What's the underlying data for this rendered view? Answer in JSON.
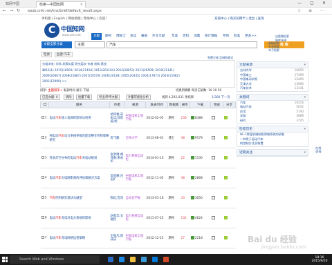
{
  "browser": {
    "tab_inactive": "知网中国",
    "tab_active": "检索—中国知网",
    "url": "epub.cnki.net/kns/brief/default_result.aspx",
    "win_controls": [
      "—",
      "▢",
      "✕"
    ]
  },
  "topline": {
    "left": "手机版 | English | 网站地图 | 帮助中心 | 欢迎！",
    "right": "充值中心 | 购买知网卡 | 退出 | 查询"
  },
  "logo": {
    "main": "中国知网",
    "letter": "C",
    "site": "www.cnki.net"
  },
  "db_tabs": [
    "文献",
    "期刊",
    "博硕士",
    "会议",
    "报纸",
    "外文文献",
    "年鉴",
    "百科",
    "词典",
    "统计数据",
    "专利",
    "标准",
    "更多>>"
  ],
  "side_links": [
    "出版物检索",
    "跨库选择",
    "新版入口",
    "充值",
    "服务导航"
  ],
  "search": {
    "scope_label": "文献全部分类",
    "field": "主题",
    "query": "汽车",
    "button": "检 索",
    "advanced": [
      "高级检索",
      "专业检索",
      "句子检索",
      "一框式检索"
    ]
  },
  "crumb": {
    "chips": [
      "检索",
      "主题:汽车"
    ],
    "right": "免费订阅  定制检索式"
  },
  "filter": {
    "row1": "分组浏览: 学科 发表年度 研究层次 作者 机构 基金",
    "row2": "2016(1)  2015(16991)  2014(21416)  2013(201104)  2012(28053)  2011(26509)  2010(31141)",
    "row3": "2009(26667)  2008(25887)  2007(20578)  2006(20138)  2005(20445)  2004(17873)  2003(15082)",
    "row4": "2002(12990)  >>",
    "close": "×"
  },
  "sort": {
    "label": "排序:",
    "active": "主题排序↓",
    "others": "发表时间 被引 下载",
    "right": "切换到摘要  每页记录数: 10 20 50"
  },
  "actions": {
    "buttons": [
      "已选文献: 0",
      "清除",
      "批量下载",
      "导出/参考文献",
      "计量可视化分析"
    ],
    "count": "找到 4,292,031 条结果",
    "pager": "1/300 下一页"
  },
  "table": {
    "headers": [
      "",
      "题名",
      "作者",
      "来源",
      "发表时间",
      "数据库",
      "被引",
      "下载",
      "预览",
      "分享"
    ],
    "rows": [
      {
        "n": "1",
        "title_a": "电动",
        "title_hl": "汽车",
        "title_b": "接入电网的影响与利用",
        "author": "胡泽春;宋永华;徐智威;胡",
        "source": "中国电机工程学报",
        "date": "2012-02-05",
        "db": "期刊",
        "cite": "236",
        "down": "8388"
      },
      {
        "n": "2",
        "title_a": "纯电动",
        "title_hl": "汽车",
        "title_b": "动力系统参数匹配及整车控制策略研究",
        "author": "周飞鲲",
        "source": "吉林大学",
        "date": "2013-06-01",
        "db": "博士",
        "cite": "38",
        "down": "9579"
      },
      {
        "n": "3",
        "title_a": "考虑灯空分布的电动",
        "title_hl": "汽车",
        "title_b": "充电站规划",
        "author": "张洪财;胡泽春;宋永华",
        "source": "电力系统自动化",
        "date": "2014-01-10",
        "db": "期刊",
        "cite": "22",
        "down": "1530"
      },
      {
        "n": "4",
        "title_a": "电动",
        "title_hl": "汽车",
        "title_b": "对电网影响的评估和解决方案",
        "author": "高亚静;吕孟扩",
        "source": "中国电机工程学报",
        "date": "2012-11-05",
        "db": "期刊",
        "cite": "38",
        "down": "2868"
      },
      {
        "n": "5",
        "title_a": "",
        "title_hl": "汽车",
        "title_b": "控制研究现状与展望",
        "author": "陈虹;宫洵",
        "source": "自动化学报",
        "date": "2013-01-16",
        "db": "期刊",
        "cite": "33",
        "down": "3050"
      },
      {
        "n": "6",
        "title_a": "电动",
        "title_hl": "汽车",
        "title_b": "充电对电力系统的影响",
        "author": "赵俊华;文福拴",
        "source": "电力系统自动化",
        "date": "2011-07-25",
        "db": "期刊",
        "cite": "132",
        "down": "4624"
      },
      {
        "n": "7",
        "title_a": "电动",
        "title_hl": "汽车",
        "title_b": "充电网络运营策略",
        "author": "王锡凡;邵成成",
        "source": "中国电机工程学报",
        "date": "2012-12-25",
        "db": "期刊",
        "cite": "27",
        "down": "2218"
      }
    ]
  },
  "panels": [
    {
      "title": "文献来源",
      "rows": [
        [
          "吉林大学",
          "16055"
        ],
        [
          "中国电工",
          "17499"
        ],
        [
          "中国电动学报",
          "15405"
        ],
        [
          "天津大学",
          "13965"
        ],
        [
          "汽车技术",
          "13141"
        ]
      ]
    },
    {
      "title": "关键词",
      "rows": [
        [
          "汽车",
          "19216"
        ],
        [
          "电动汽车",
          "5042"
        ],
        [
          "应用",
          "5740"
        ],
        [
          "发展",
          "4888"
        ],
        [
          "研究",
          "3745"
        ]
      ]
    },
    {
      "title": "检索历史",
      "rows": [
        [
          "HL-1除湿机械制热用电系统的研制",
          ""
        ],
        [
          "一种用于混动汽车",
          ""
        ],
        [
          "的控制方法及装置",
          ""
        ]
      ]
    },
    {
      "title": "近期关注",
      "rows": []
    }
  ],
  "feedback": "在线咨询",
  "taskbar": {
    "search": "Search Web and Windows",
    "time": "18:16",
    "date": "2015/9/20"
  },
  "watermark": {
    "main": "Bai du 经验",
    "sub": "jingyan.baidu.com"
  }
}
